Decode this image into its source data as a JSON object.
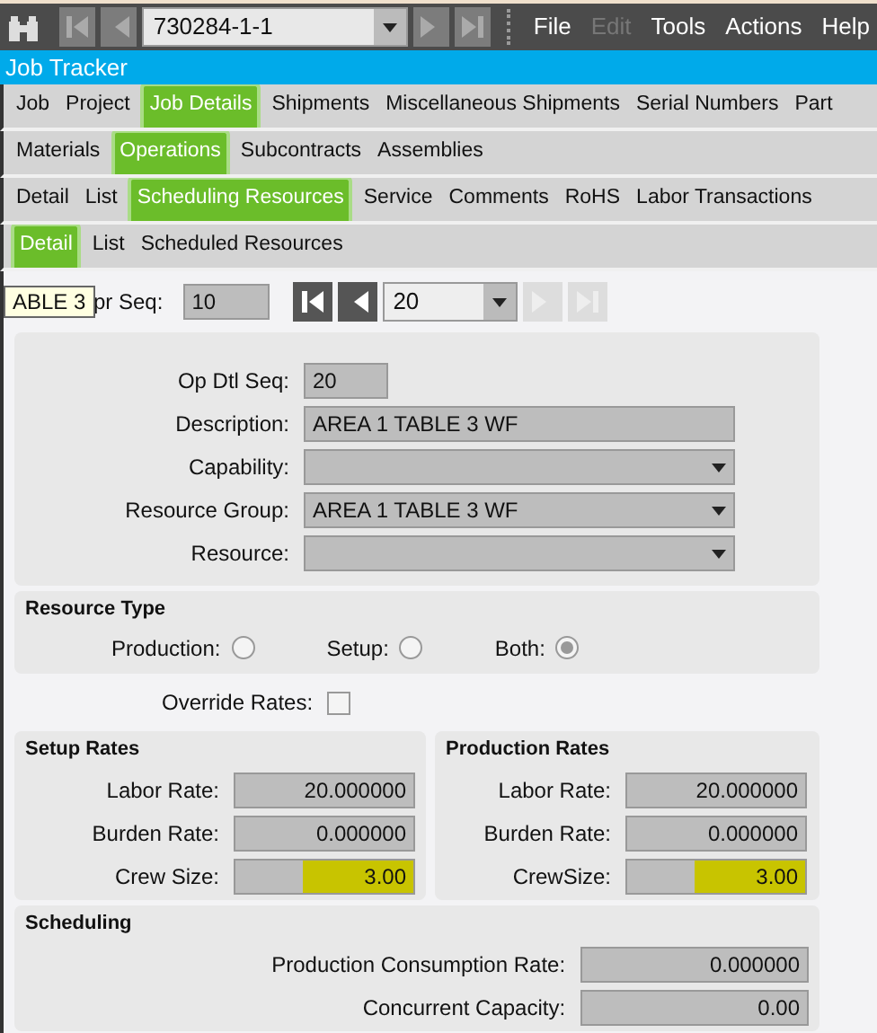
{
  "toolbar": {
    "record": "730284-1-1",
    "menu": [
      {
        "label": "File",
        "disabled": false
      },
      {
        "label": "Edit",
        "disabled": true
      },
      {
        "label": "Tools",
        "disabled": false
      },
      {
        "label": "Actions",
        "disabled": false
      },
      {
        "label": "Help",
        "disabled": false
      }
    ]
  },
  "window": {
    "title": "Job Tracker"
  },
  "tab_rows": [
    [
      {
        "label": "Job",
        "selected": false
      },
      {
        "label": "Project",
        "selected": false
      },
      {
        "label": "Job Details",
        "selected": true
      },
      {
        "label": "Shipments",
        "selected": false
      },
      {
        "label": "Miscellaneous Shipments",
        "selected": false
      },
      {
        "label": "Serial Numbers",
        "selected": false
      },
      {
        "label": "Part",
        "selected": false
      }
    ],
    [
      {
        "label": "Materials",
        "selected": false
      },
      {
        "label": "Operations",
        "selected": true
      },
      {
        "label": "Subcontracts",
        "selected": false
      },
      {
        "label": "Assemblies",
        "selected": false
      }
    ],
    [
      {
        "label": "Detail",
        "selected": false
      },
      {
        "label": "List",
        "selected": false
      },
      {
        "label": "Scheduling Resources",
        "selected": true
      },
      {
        "label": "Service",
        "selected": false
      },
      {
        "label": "Comments",
        "selected": false
      },
      {
        "label": "RoHS",
        "selected": false
      },
      {
        "label": "Labor Transactions",
        "selected": false
      }
    ],
    [
      {
        "label": "Detail",
        "selected": true
      },
      {
        "label": "List",
        "selected": false
      },
      {
        "label": "Scheduled Resources",
        "selected": false
      }
    ]
  ],
  "tooltip": "ABLE 3",
  "opr_seq": {
    "label": "pr Seq:",
    "value": "10",
    "detail_seq": "20"
  },
  "detail": [
    {
      "label": "Op Dtl Seq:",
      "value": "20",
      "kind": "short"
    },
    {
      "label": "Description:",
      "value": "AREA 1 TABLE 3 WF",
      "kind": "text"
    },
    {
      "label": "Capability:",
      "kind": "combo"
    },
    {
      "label": "Resource Group:",
      "value": "AREA 1 TABLE 3 WF",
      "kind": "combo"
    },
    {
      "label": "Resource:",
      "kind": "combo"
    }
  ],
  "resource_type": {
    "title": "Resource Type",
    "options": [
      {
        "label": "Production:",
        "selected": false
      },
      {
        "label": "Setup:",
        "selected": false
      },
      {
        "label": "Both:",
        "selected": true
      }
    ]
  },
  "override_rates": {
    "label": "Override Rates:",
    "checked": false
  },
  "rate_panels": [
    {
      "title": "Setup Rates",
      "fields": [
        {
          "label": "Labor Rate:",
          "value": "20.000000",
          "highlighted": false
        },
        {
          "label": "Burden Rate:",
          "value": "0.000000",
          "highlighted": false
        },
        {
          "label": "Crew Size:",
          "value": "3.00",
          "highlighted": true
        }
      ]
    },
    {
      "title": "Production Rates",
      "fields": [
        {
          "label": "Labor Rate:",
          "value": "20.000000",
          "highlighted": false
        },
        {
          "label": "Burden Rate:",
          "value": "0.000000",
          "highlighted": false
        },
        {
          "label": "CrewSize:",
          "value": "3.00",
          "highlighted": true
        }
      ]
    }
  ],
  "scheduling": {
    "title": "Scheduling",
    "fields": [
      {
        "label": "Production Consumption Rate:",
        "value": "0.000000"
      },
      {
        "label": "Concurrent Capacity:",
        "value": "0.00"
      }
    ]
  }
}
